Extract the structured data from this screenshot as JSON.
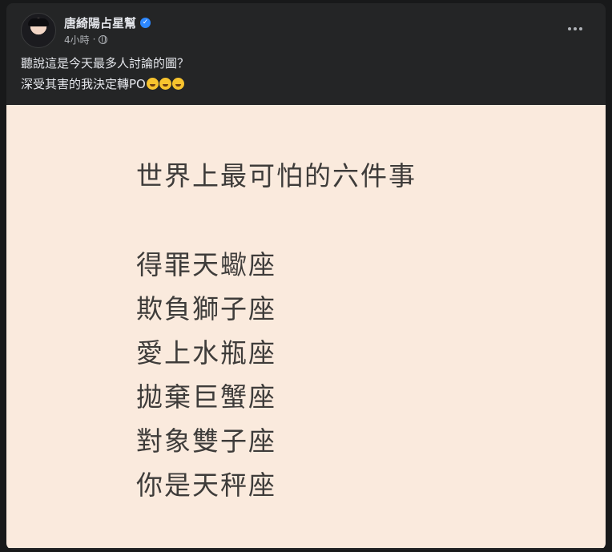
{
  "post": {
    "author": "唐綺陽占星幫",
    "verified": true,
    "time": "4小時",
    "separator": "·",
    "privacy_icon": "globe-icon",
    "more_icon": "ellipsis-icon",
    "lines": [
      "聽說這是今天最多人討論的圖？",
      "深受其害的我決定轉PO"
    ],
    "emoji_count": 3,
    "emoji_icon": "rolling-on-floor-laughing-emoji"
  },
  "image": {
    "title": "世界上最可怕的六件事",
    "items": [
      "得罪天蠍座",
      "欺負獅子座",
      "愛上水瓶座",
      "拋棄巨蟹座",
      "對象雙子座",
      "你是天秤座"
    ]
  },
  "colors": {
    "background": "#18191a",
    "card": "#242526",
    "primary_text": "#e4e6eb",
    "secondary_text": "#b0b3b8",
    "verified_badge": "#2d88ff",
    "image_background": "#faeadd",
    "image_text": "#3e3c3a"
  }
}
